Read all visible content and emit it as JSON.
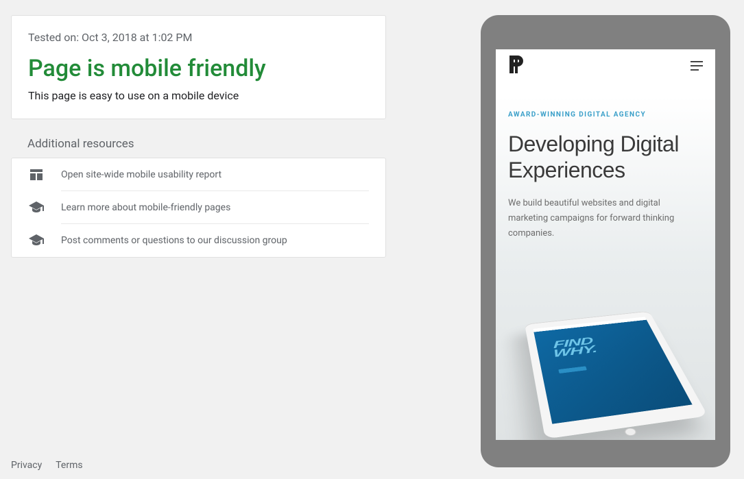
{
  "result": {
    "tested_label": "Tested on: Oct 3, 2018 at 1:02 PM",
    "headline": "Page is mobile friendly",
    "subtext": "This page is easy to use on a mobile device"
  },
  "resources": {
    "section_label": "Additional resources",
    "items": [
      {
        "icon": "web-layout",
        "label": "Open site-wide mobile usability report"
      },
      {
        "icon": "scholar",
        "label": "Learn more about mobile-friendly pages"
      },
      {
        "icon": "scholar",
        "label": "Post comments or questions to our discussion group"
      }
    ]
  },
  "footer": {
    "privacy": "Privacy",
    "terms": "Terms"
  },
  "preview": {
    "eyebrow": "AWARD-WINNING DIGITAL AGENCY",
    "title": "Developing Digital Experiences",
    "desc": "We build beautiful websites and digital marketing campaigns for forward thinking companies.",
    "tablet_text_1": "FIND",
    "tablet_text_2": "WHY."
  }
}
